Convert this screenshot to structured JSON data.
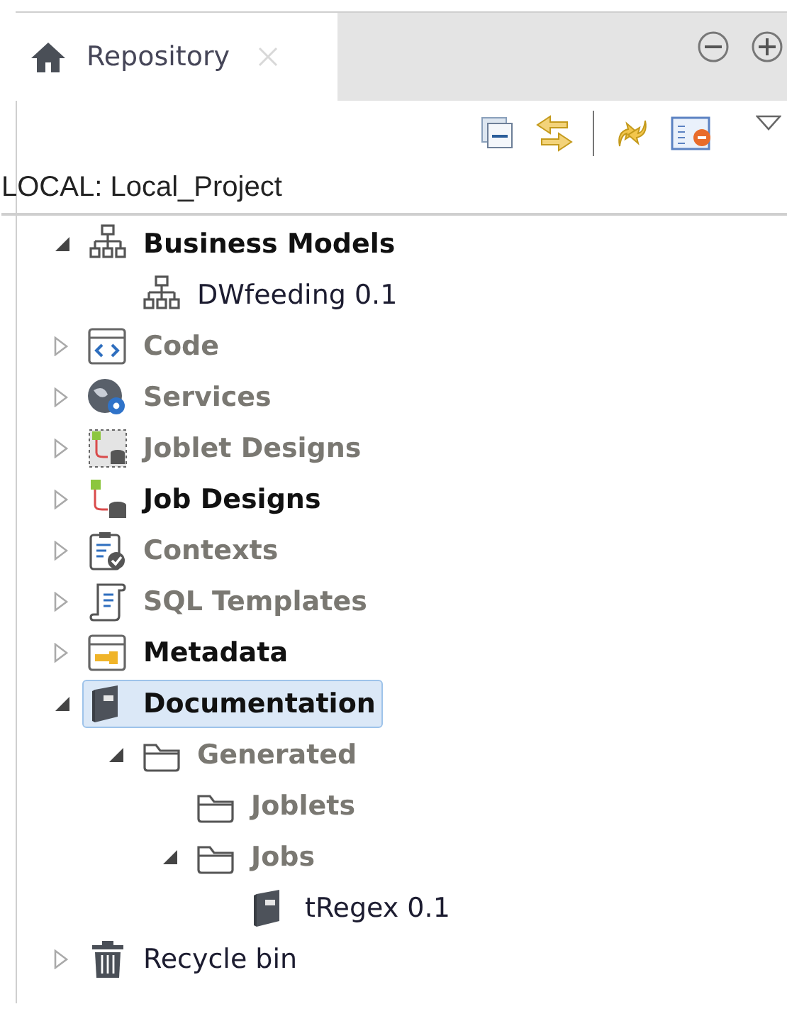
{
  "tab": {
    "label": "Repository",
    "selected": true
  },
  "project_label": "LOCAL: Local_Project",
  "tree": [
    {
      "label": "Business Models",
      "kind": "hierarchy",
      "emphasized": true,
      "disabled": false,
      "expanded": true,
      "selected": false,
      "children": [
        {
          "label": "DWfeeding 0.1",
          "kind": "hierarchy",
          "emphasized": false,
          "disabled": false,
          "expandable": false,
          "expanded": false,
          "selected": false
        }
      ]
    },
    {
      "label": "Code",
      "kind": "code",
      "emphasized": true,
      "disabled": true,
      "expandable": true,
      "expanded": false,
      "selected": false
    },
    {
      "label": "Services",
      "kind": "globe",
      "emphasized": true,
      "disabled": true,
      "expandable": true,
      "expanded": false,
      "selected": false
    },
    {
      "label": "Joblet Designs",
      "kind": "joblet",
      "emphasized": true,
      "disabled": true,
      "expandable": true,
      "expanded": false,
      "selected": false
    },
    {
      "label": "Job Designs",
      "kind": "job",
      "emphasized": true,
      "disabled": false,
      "expandable": true,
      "expanded": false,
      "selected": false
    },
    {
      "label": "Contexts",
      "kind": "clipboard",
      "emphasized": true,
      "disabled": true,
      "expandable": true,
      "expanded": false,
      "selected": false
    },
    {
      "label": "SQL Templates",
      "kind": "scroll",
      "emphasized": true,
      "disabled": true,
      "expandable": true,
      "expanded": false,
      "selected": false
    },
    {
      "label": "Metadata",
      "kind": "metadata",
      "emphasized": true,
      "disabled": false,
      "expandable": true,
      "expanded": false,
      "selected": false
    },
    {
      "label": "Documentation",
      "kind": "book",
      "emphasized": true,
      "disabled": false,
      "expanded": true,
      "selected": true,
      "children": [
        {
          "label": "Generated",
          "kind": "folder",
          "emphasized": true,
          "disabled": true,
          "expanded": true,
          "selected": false,
          "children": [
            {
              "label": "Joblets",
              "kind": "folder",
              "emphasized": true,
              "disabled": true,
              "expandable": false,
              "expanded": false,
              "selected": false
            },
            {
              "label": "Jobs",
              "kind": "folder",
              "emphasized": true,
              "disabled": true,
              "expanded": true,
              "selected": false,
              "children": [
                {
                  "label": "tRegex 0.1",
                  "kind": "book",
                  "emphasized": false,
                  "disabled": false,
                  "expandable": false,
                  "expanded": false,
                  "selected": false
                }
              ]
            }
          ]
        }
      ]
    },
    {
      "label": "Recycle bin",
      "kind": "trash",
      "emphasized": false,
      "disabled": false,
      "expandable": true,
      "expanded": false,
      "selected": false
    }
  ]
}
